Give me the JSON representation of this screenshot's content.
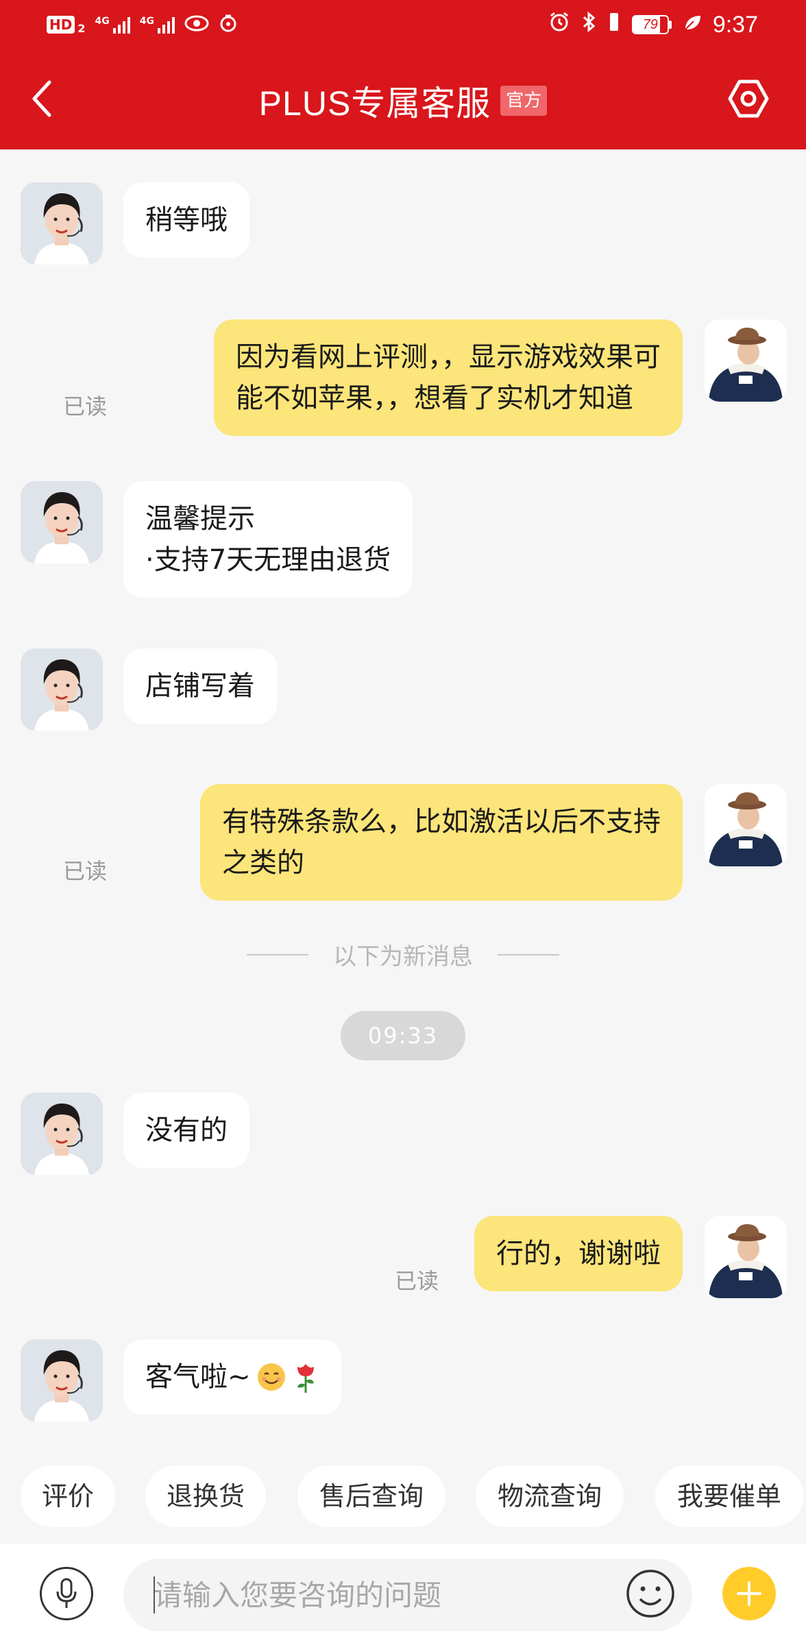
{
  "status_bar": {
    "hd_label": "HD",
    "hd_sub": "2",
    "net1": "4G",
    "net2": "4G",
    "battery_level": "79",
    "time": "9:37"
  },
  "header": {
    "title": "PLUS专属客服",
    "badge": "官方",
    "back_icon": "chevron-left-icon",
    "settings_icon": "settings-hexagon-icon"
  },
  "messages": [
    {
      "sender": "agent",
      "text": "稍等哦"
    },
    {
      "sender": "user",
      "lines": [
        "因为看网上评测，，显示游戏效果可",
        "能不如苹果，，想看了实机才知道"
      ],
      "read": "已读"
    },
    {
      "sender": "agent",
      "lines": [
        "温馨提示",
        "·支持7天无理由退货"
      ]
    },
    {
      "sender": "agent",
      "text": "店铺写着"
    },
    {
      "sender": "user",
      "lines": [
        "有特殊条款么，比如激活以后不支持",
        "之类的"
      ],
      "read": "已读"
    },
    {
      "sender": "agent",
      "text": "没有的"
    },
    {
      "sender": "user",
      "text": "行的，谢谢啦",
      "read": "已读"
    },
    {
      "sender": "agent",
      "text": "客气啦~",
      "emojis": [
        "smiling-face-icon",
        "rose-icon"
      ]
    }
  ],
  "divider_text": "以下为新消息",
  "timestamp": "09:33",
  "quick_replies": [
    "评价",
    "退换货",
    "售后查询",
    "物流查询",
    "我要催单"
  ],
  "input": {
    "placeholder": "请输入您要咨询的问题",
    "value": ""
  },
  "colors": {
    "header_red": "#d8161b",
    "user_bubble": "#fce57a",
    "agent_bubble": "#ffffff",
    "plus_button": "#ffcc2a"
  }
}
